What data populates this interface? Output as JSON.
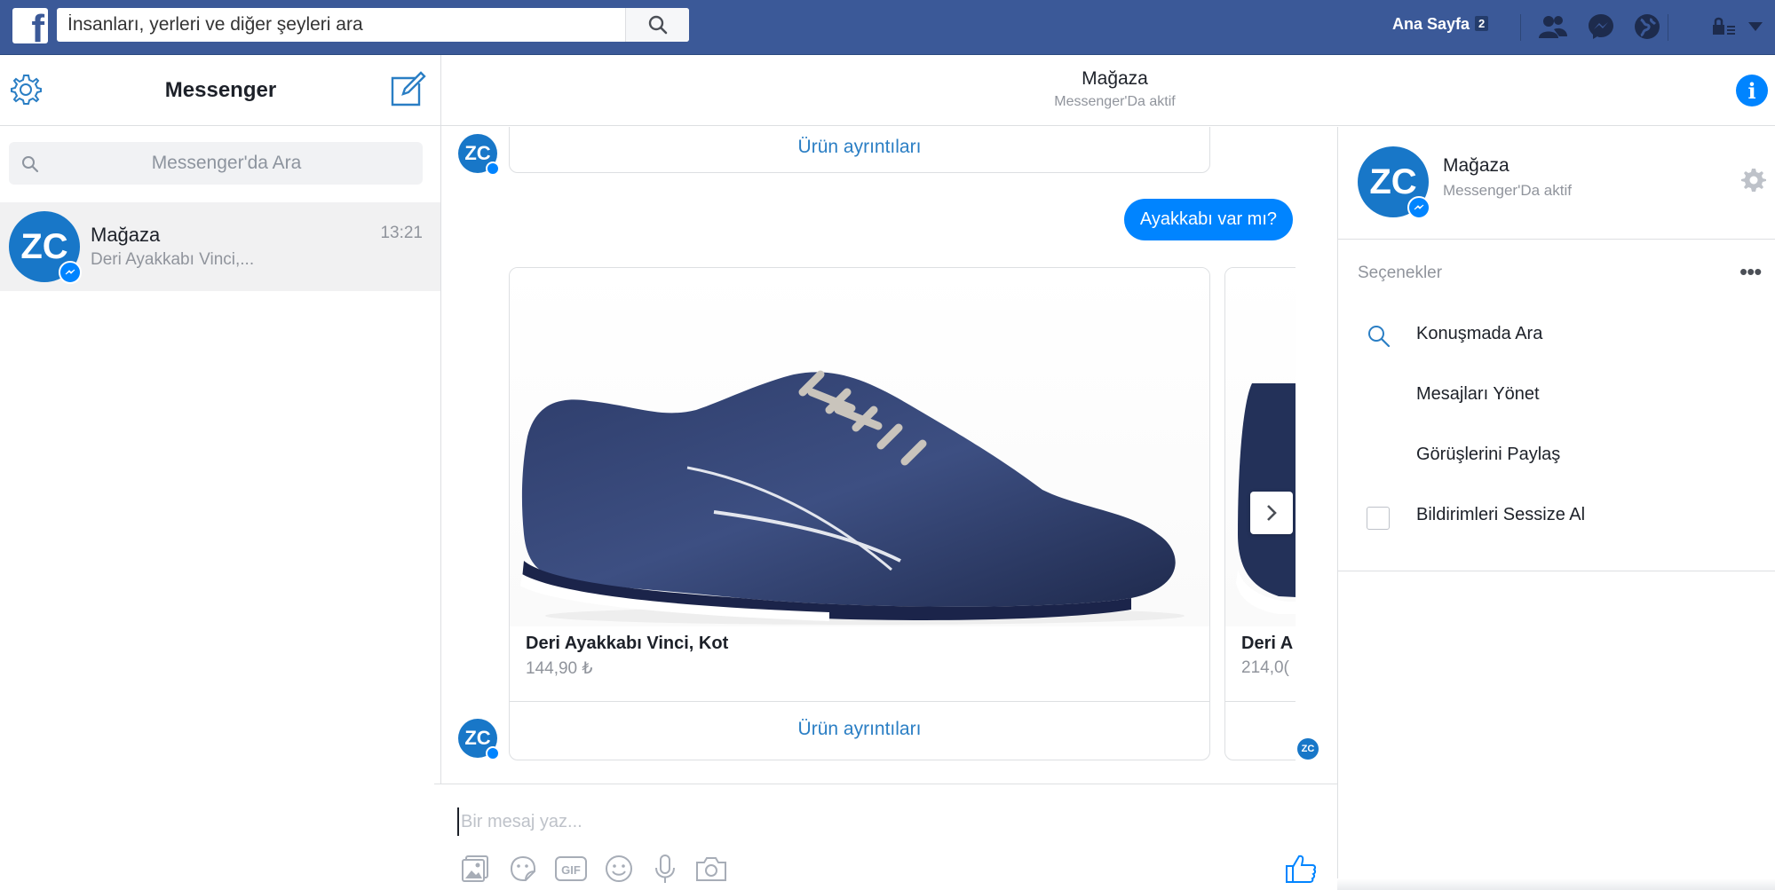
{
  "topbar": {
    "logo": "f",
    "search_placeholder": "İnsanları, yerleri ve diğer şeyleri ara",
    "home_label": "Ana Sayfa",
    "home_count": "2",
    "icons": [
      "friends-icon",
      "messenger-icon",
      "globe-icon",
      "lock-menu-icon",
      "caret-down-icon"
    ]
  },
  "left": {
    "title": "Messenger",
    "search_placeholder": "Messenger'da Ara",
    "threads": [
      {
        "avatar": "ZC",
        "name": "Mağaza",
        "time": "13:21",
        "snippet": "Deri Ayakkabı Vinci,..."
      }
    ]
  },
  "conversation": {
    "title": "Mağaza",
    "status": "Messenger'Da aktif",
    "card_button_top": "Ürün ayrıntıları",
    "sent_message": "Ayakkabı var mı?",
    "products": [
      {
        "title": "Deri Ayakkabı Vinci, Kot",
        "price": "144,90 ₺",
        "button": "Ürün ayrıntıları"
      },
      {
        "title": "Deri A",
        "price": "214,0("
      }
    ],
    "composer_placeholder": "Bir mesaj yaz...",
    "avatar": "ZC"
  },
  "right": {
    "name": "Mağaza",
    "status": "Messenger'Da aktif",
    "options_label": "Seçenekler",
    "more": "•••",
    "items": [
      {
        "label": "Konuşmada Ara",
        "icon": "search-icon"
      },
      {
        "label": "Mesajları Yönet",
        "icon": ""
      },
      {
        "label": "Görüşlerini Paylaş",
        "icon": ""
      },
      {
        "label": "Bildirimleri Sessize Al",
        "icon": "checkbox"
      }
    ]
  },
  "colors": {
    "fb_blue": "#3b5998",
    "messenger_blue": "#0084ff",
    "link_blue": "#2a7ec4",
    "avatar_blue": "#1877c8",
    "muted": "#90949c"
  }
}
